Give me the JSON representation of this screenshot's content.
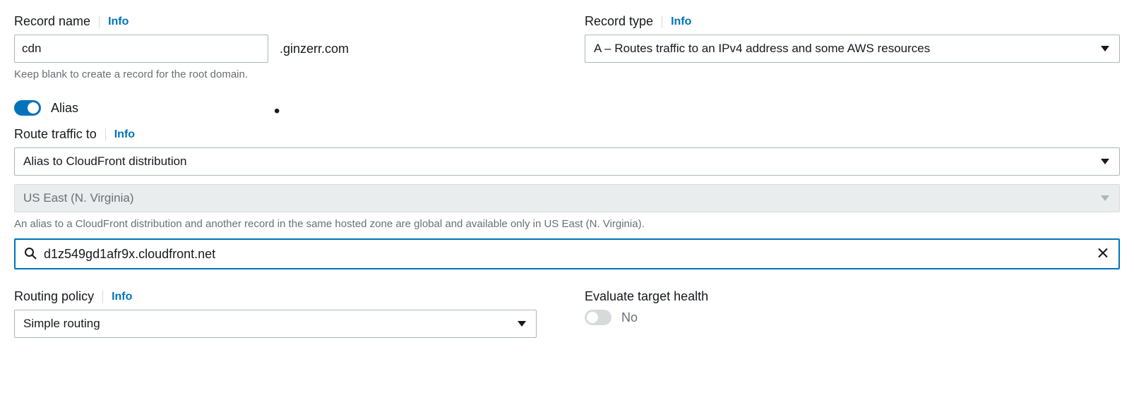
{
  "record_name": {
    "label": "Record name",
    "info": "Info",
    "value": "cdn",
    "suffix": ".ginzerr.com",
    "help": "Keep blank to create a record for the root domain."
  },
  "record_type": {
    "label": "Record type",
    "info": "Info",
    "value": "A – Routes traffic to an IPv4 address and some AWS resources"
  },
  "alias": {
    "label": "Alias"
  },
  "route_traffic_to": {
    "label": "Route traffic to",
    "info": "Info",
    "alias_target": "Alias to CloudFront distribution",
    "region": "US East (N. Virginia)",
    "region_help": "An alias to a CloudFront distribution and another record in the same hosted zone are global and available only in US East (N. Virginia).",
    "search_value": "d1z549gd1afr9x.cloudfront.net"
  },
  "routing_policy": {
    "label": "Routing policy",
    "info": "Info",
    "value": "Simple routing"
  },
  "evaluate_health": {
    "label": "Evaluate target health",
    "value": "No"
  }
}
